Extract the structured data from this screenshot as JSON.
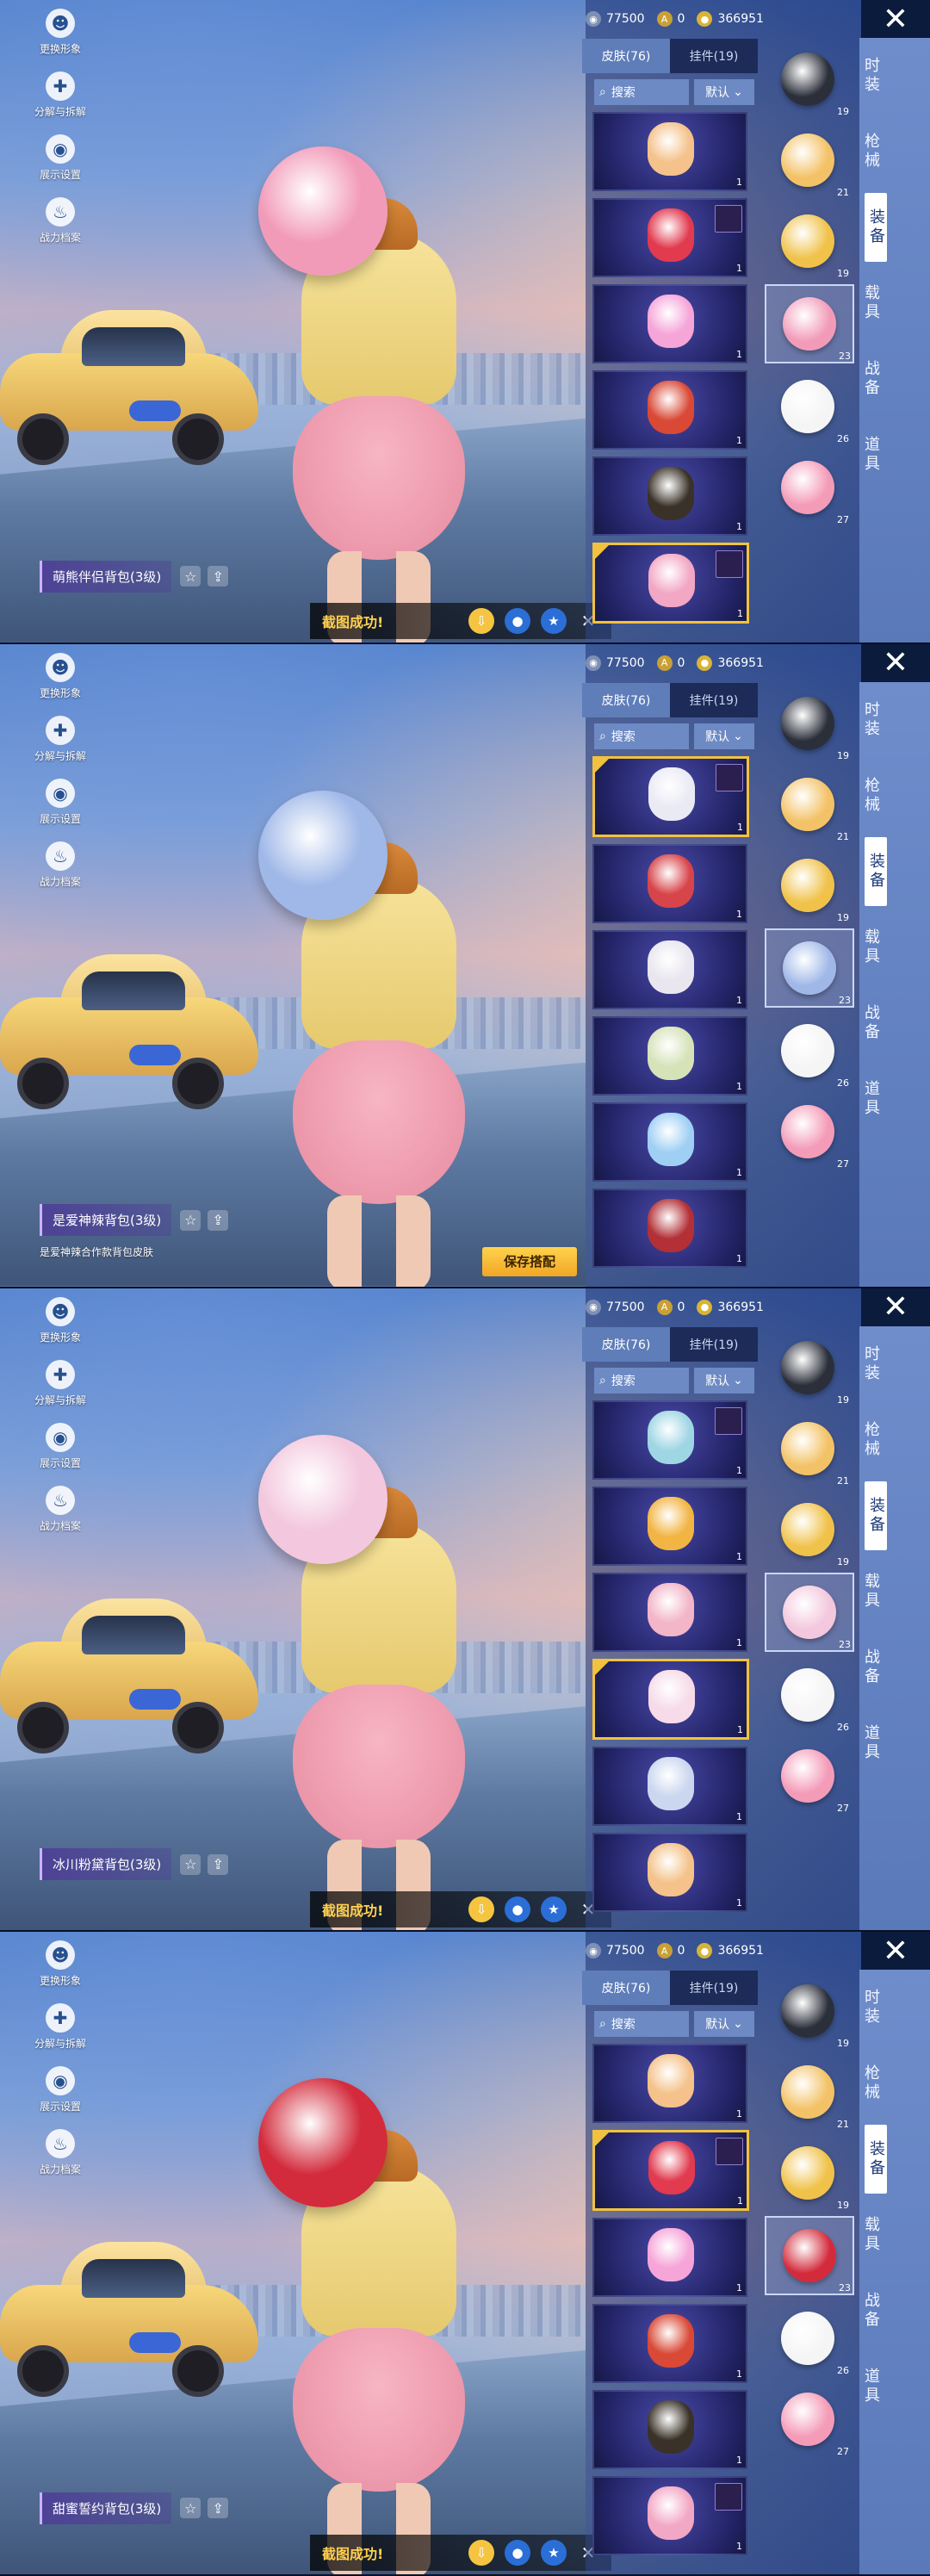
{
  "colors": {
    "accent_gold": "#f2c23e",
    "panel_blue": "#5f7db9",
    "toast_text": "#ffd14f"
  },
  "left_menu": [
    {
      "label": "更换形象",
      "icon": "avatar-icon"
    },
    {
      "label": "分解与拆解",
      "icon": "puzzle-icon"
    },
    {
      "label": "展示设置",
      "icon": "eye-icon"
    },
    {
      "label": "战力档案",
      "icon": "flame-icon"
    }
  ],
  "currency": {
    "bp": "77500",
    "uc": "0",
    "coupons": "366951"
  },
  "tabs": {
    "skins": "皮肤(76)",
    "pendants": "挂件(19)"
  },
  "search": {
    "label": "搜索",
    "sort": "默认"
  },
  "categories": [
    "时装",
    "枪械",
    "装备",
    "载具",
    "战备",
    "道具"
  ],
  "active_category_index": 2,
  "loadout_levels": [
    "19",
    "21",
    "19",
    "23",
    "26",
    "27"
  ],
  "panels": [
    {
      "item_name": "萌熊伴侣背包(3级)",
      "item_desc": "",
      "toast": "截图成功!",
      "save_label": "",
      "pack_color": "#f29bb9",
      "list": [
        {
          "color": "#f4c28a",
          "tag": false,
          "count": "1",
          "selected": false
        },
        {
          "color": "#e23a4e",
          "tag": true,
          "count": "1",
          "selected": false
        },
        {
          "color": "#f6a5d9",
          "tag": false,
          "count": "1",
          "selected": false
        },
        {
          "color": "#d94936",
          "tag": false,
          "count": "1",
          "selected": false
        },
        {
          "color": "#3a3228",
          "tag": false,
          "count": "1",
          "selected": false
        },
        {
          "color": "#f2a7c4",
          "tag": true,
          "count": "1",
          "selected": true
        }
      ]
    },
    {
      "item_name": "是爱神辣背包(3级)",
      "item_desc": "是爱神辣合作款背包皮肤",
      "toast": "",
      "save_label": "保存搭配",
      "pack_color": "#9fb8e8",
      "list": [
        {
          "color": "#eaeaf5",
          "tag": true,
          "count": "1",
          "selected": true
        },
        {
          "color": "#d7454a",
          "tag": false,
          "count": "1",
          "selected": false
        },
        {
          "color": "#e9e6ef",
          "tag": false,
          "count": "1",
          "selected": false
        },
        {
          "color": "#d6e3b9",
          "tag": false,
          "count": "1",
          "selected": false
        },
        {
          "color": "#9fd0f4",
          "tag": false,
          "count": "1",
          "selected": false
        },
        {
          "color": "#b23036",
          "tag": false,
          "count": "1",
          "selected": false
        }
      ]
    },
    {
      "item_name": "冰川粉黛背包(3级)",
      "item_desc": "",
      "toast": "截图成功!",
      "save_label": "",
      "pack_color": "#f3c7dd",
      "list": [
        {
          "color": "#9fd6e4",
          "tag": true,
          "count": "1",
          "selected": false
        },
        {
          "color": "#f2b544",
          "tag": false,
          "count": "1",
          "selected": false
        },
        {
          "color": "#f3b5c8",
          "tag": false,
          "count": "1",
          "selected": false
        },
        {
          "color": "#f7dbe8",
          "tag": false,
          "count": "1",
          "selected": true
        },
        {
          "color": "#cbd7ef",
          "tag": false,
          "count": "1",
          "selected": false
        },
        {
          "color": "#f4c28a",
          "tag": false,
          "count": "1",
          "selected": false
        }
      ]
    },
    {
      "item_name": "甜蜜誓约背包(3级)",
      "item_desc": "",
      "toast": "截图成功!",
      "save_label": "",
      "pack_color": "#d32b3c",
      "list": [
        {
          "color": "#f4c28a",
          "tag": false,
          "count": "1",
          "selected": false
        },
        {
          "color": "#e23a4e",
          "tag": true,
          "count": "1",
          "selected": true
        },
        {
          "color": "#f6a5d9",
          "tag": false,
          "count": "1",
          "selected": false
        },
        {
          "color": "#d94936",
          "tag": false,
          "count": "1",
          "selected": false
        },
        {
          "color": "#3a3228",
          "tag": false,
          "count": "1",
          "selected": false
        },
        {
          "color": "#f2a7c4",
          "tag": true,
          "count": "1",
          "selected": false
        }
      ]
    }
  ]
}
